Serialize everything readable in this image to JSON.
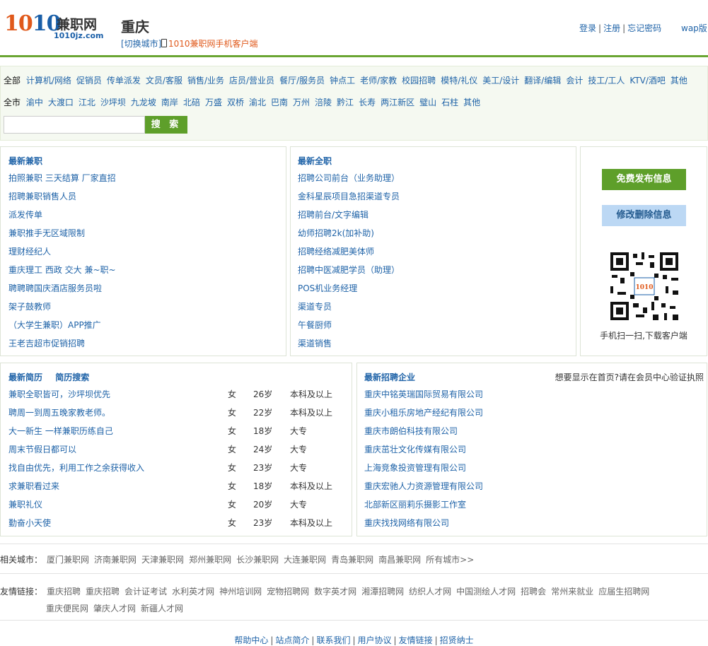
{
  "header": {
    "logo_num_1": "10",
    "logo_num_2": "10",
    "logo_cn": "兼职网",
    "logo_domain": "1010jz.com",
    "city": "重庆",
    "switch_city": "[切换城市]",
    "mobile_client": "1010兼职网手机客户端",
    "login": "登录",
    "register": "注册",
    "forgot": "忘记密码",
    "sep": "|",
    "wap": "wap版"
  },
  "filters": {
    "category_label": "全部",
    "categories": [
      "计算机/网络",
      "促销员",
      "传单派发",
      "文员/客服",
      "销售/业务",
      "店员/营业员",
      "餐厅/服务员",
      "钟点工",
      "老师/家教",
      "校园招聘",
      "模特/礼仪",
      "美工/设计",
      "翻译/编辑",
      "会计",
      "技工/工人",
      "KTV/酒吧",
      "其他"
    ],
    "area_label": "全市",
    "areas": [
      "渝中",
      "大渡口",
      "江北",
      "沙坪坝",
      "九龙坡",
      "南岸",
      "北碚",
      "万盛",
      "双桥",
      "渝北",
      "巴南",
      "万州",
      "涪陵",
      "黔江",
      "长寿",
      "两江新区",
      "璧山",
      "石柱",
      "其他"
    ],
    "search_button": "搜 索"
  },
  "parttime": {
    "title": "最新兼职",
    "items": [
      "拍照兼职 三天结算 厂家直招",
      "招聘兼职销售人员",
      "派发传单",
      "兼职推手无区域限制",
      "理财经纪人",
      "重庆理工 西政 交大 兼~职~",
      "聘聘聘国庆酒店服务员啦",
      "架子鼓教师",
      "（大学生兼职）APP推广",
      "王老吉超市促销招聘"
    ]
  },
  "fulltime": {
    "title": "最新全职",
    "items": [
      "招聘公司前台（业务助理）",
      "金科星辰项目急招渠道专员",
      "招聘前台/文字编辑",
      "幼师招聘2k(加补助)",
      "招聘经络减肥美体师",
      "招聘中医减肥学员（助理）",
      "POS机业务经理",
      "渠道专员",
      "午餐厨师",
      "渠道销售"
    ]
  },
  "side": {
    "publish": "免费发布信息",
    "edit": "修改删除信息",
    "qr_caption": "手机扫一扫,下载客户端",
    "qr_center": "1010"
  },
  "resumes": {
    "title": "最新简历",
    "search_link": "简历搜索",
    "rows": [
      {
        "title": "兼职全职皆可，沙坪坝优先",
        "gender": "女",
        "age": "26岁",
        "edu": "本科及以上"
      },
      {
        "title": "聘周一到周五晚家教老师。",
        "gender": "女",
        "age": "22岁",
        "edu": "本科及以上"
      },
      {
        "title": "大一新生 一样兼职历练自己",
        "gender": "女",
        "age": "18岁",
        "edu": "大专"
      },
      {
        "title": "周末节假日都可以",
        "gender": "女",
        "age": "24岁",
        "edu": "大专"
      },
      {
        "title": "找自由优先，利用工作之余获得收入",
        "gender": "女",
        "age": "23岁",
        "edu": "大专"
      },
      {
        "title": "求兼职看过来",
        "gender": "女",
        "age": "18岁",
        "edu": "本科及以上"
      },
      {
        "title": "兼职礼仪",
        "gender": "女",
        "age": "20岁",
        "edu": "大专"
      },
      {
        "title": "勤奋小天使",
        "gender": "女",
        "age": "23岁",
        "edu": "本科及以上"
      }
    ]
  },
  "companies": {
    "title": "最新招聘企业",
    "note": "想要显示在首页?请在会员中心验证执照",
    "items": [
      "重庆中铭英瑞国际贸易有限公司",
      "重庆小租乐房地产经纪有限公司",
      "重庆市朗伯科技有限公司",
      "重庆茁壮文化传媒有限公司",
      "上海竞象投资管理有限公司",
      "重庆宏驰人力资源管理有限公司",
      "北部新区丽莉乐摄影工作室",
      "重庆找找网络有限公司"
    ]
  },
  "related": {
    "label": "相关城市：",
    "items": [
      "厦门兼职网",
      "济南兼职网",
      "天津兼职网",
      "郑州兼职网",
      "长沙兼职网",
      "大连兼职网",
      "青岛兼职网",
      "南昌兼职网",
      "所有城市>>"
    ]
  },
  "friends": {
    "label": "友情链接：",
    "line1": [
      "重庆招聘",
      "重庆招聘",
      "会计证考试",
      "水利英才网",
      "神州培训网",
      "宠物招聘网",
      "数字英才网",
      "湘潭招聘网",
      "纺织人才网",
      "中国测绘人才网",
      "招聘会",
      "常州来就业",
      "应届生招聘网"
    ],
    "line2": [
      "重庆便民网",
      "肇庆人才网",
      "新疆人才网"
    ]
  },
  "footer": {
    "links": [
      "帮助中心",
      "站点简介",
      "联系我们",
      "用户协议",
      "友情链接",
      "招贤纳士"
    ]
  }
}
